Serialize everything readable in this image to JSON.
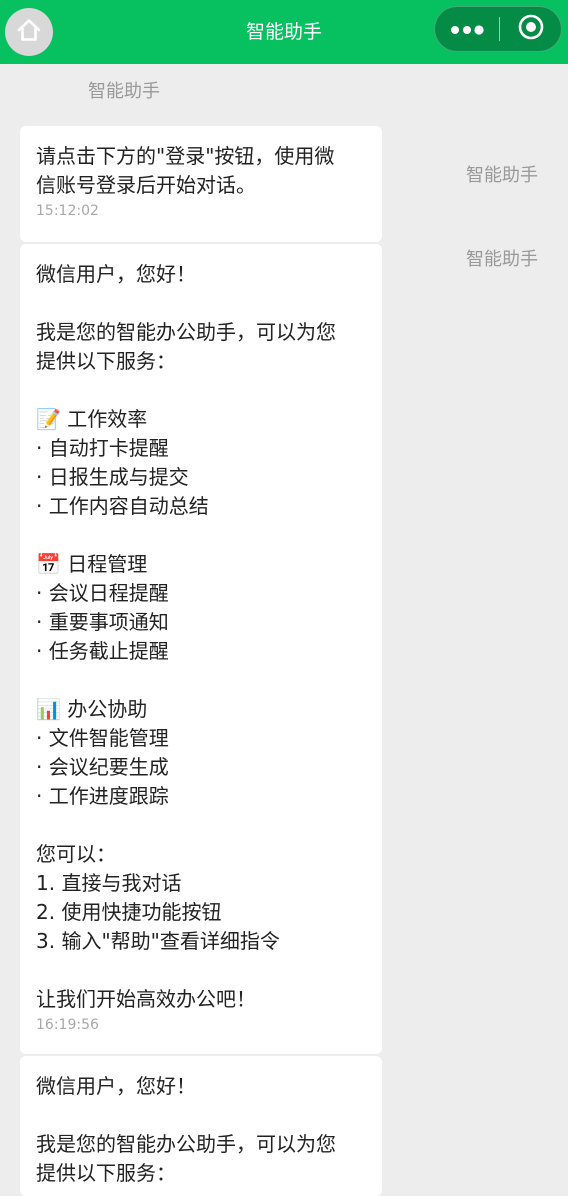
{
  "header": {
    "title": "智能助手"
  },
  "chat": {
    "top_sender": "智能助手",
    "messages": [
      {
        "sender": "智能助手",
        "text": "请点击下方的\"登录\"按钮，使用微\n信账号登录后开始对话。",
        "time": "15:12:02"
      },
      {
        "sender": "智能助手",
        "text": "微信用户，您好！\n\n我是您的智能办公助手，可以为您\n提供以下服务：\n\n📝 工作效率\n· 自动打卡提醒\n· 日报生成与提交\n· 工作内容自动总结\n\n📅 日程管理\n· 会议日程提醒\n· 重要事项通知\n· 任务截止提醒\n\n📊 办公协助\n· 文件智能管理\n· 会议纪要生成\n· 工作进度跟踪\n\n您可以：\n1. 直接与我对话\n2. 使用快捷功能按钮\n3. 输入\"帮助\"查看详细指令\n\n让我们开始高效办公吧！",
        "time": "16:19:56"
      },
      {
        "text": "微信用户，您好！\n\n我是您的智能办公助手，可以为您\n提供以下服务："
      }
    ]
  }
}
